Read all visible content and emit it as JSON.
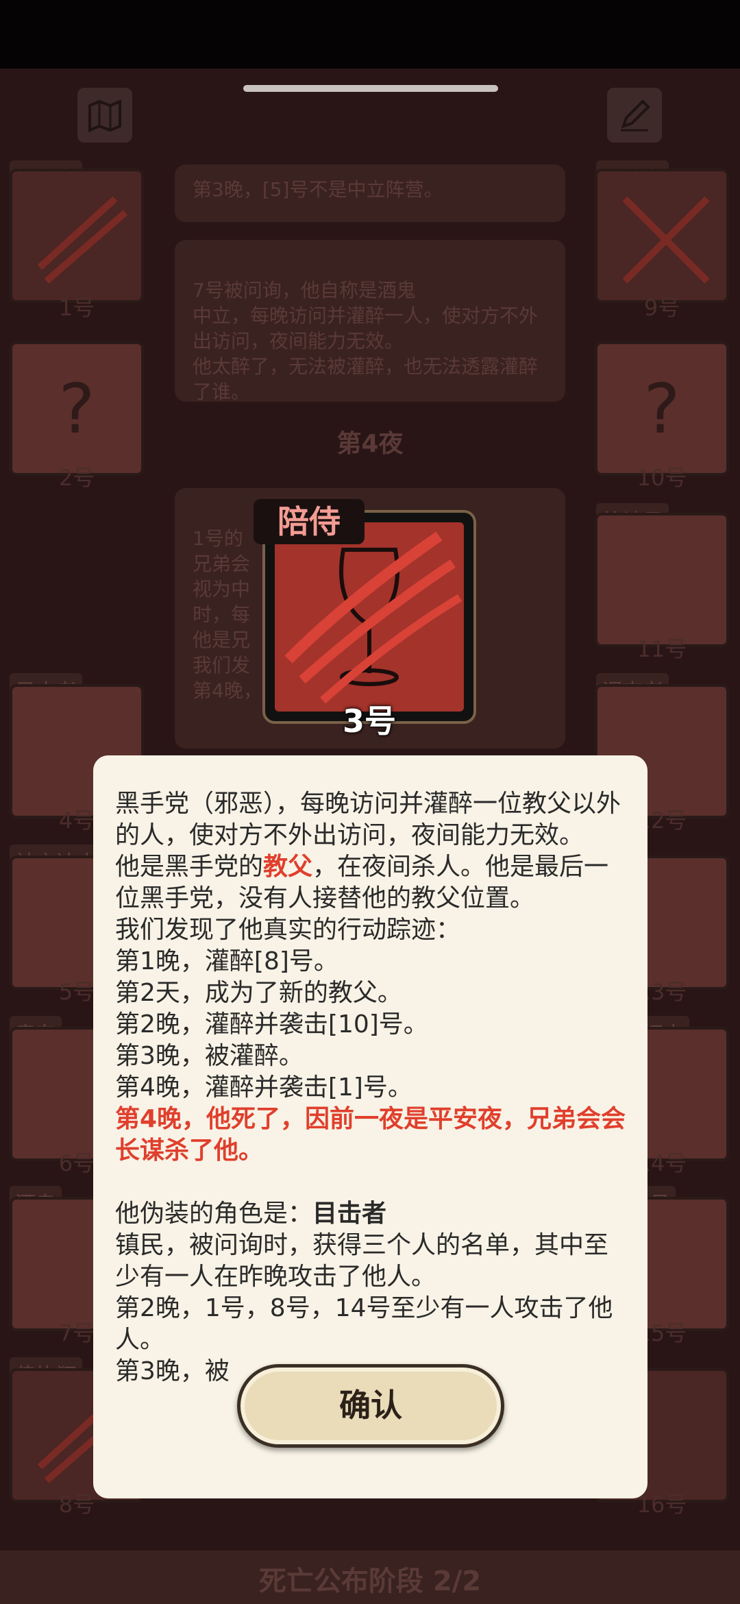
{
  "board": {
    "left_cards": [
      {
        "role": "叛变者",
        "num": "1号"
      },
      {
        "role": "",
        "num": "2号"
      },
      {
        "role": "目击者",
        "num": "4号"
      },
      {
        "role": "社交达人",
        "num": "5号"
      },
      {
        "role": "房东",
        "num": "6号"
      },
      {
        "role": "酒鬼",
        "num": "7号"
      },
      {
        "role": "偏执狂",
        "num": "8号"
      }
    ],
    "right_cards": [
      {
        "role": "伪装者",
        "num": "9号"
      },
      {
        "role": "",
        "num": "10号"
      },
      {
        "role": "统计员",
        "num": "11号"
      },
      {
        "role": "调查者",
        "num": "12号"
      },
      {
        "role": "",
        "num": "13号"
      },
      {
        "role": "证人",
        "num": "14号"
      },
      {
        "role": "员",
        "num": "15号"
      },
      {
        "role": "",
        "num": "16号"
      }
    ],
    "log1": "第3晚，[5]号不是中立阵营。",
    "log2": "7号被问询，他自称是酒鬼\n中立，每晚访问并灌醉一人，使对方不外出访问，夜间能力无效。\n他太醉了，无法被灌醉，也无法透露灌醉了谁。",
    "night_label": "第4夜",
    "log3": "1号的\n兄弟会\n视为中\n时，每\n他是兄\n我们发\n第4晚，",
    "phase": "死亡公布阶段 2/2"
  },
  "feature": {
    "badge": "陪侍",
    "num": "3号"
  },
  "dialog": {
    "p1": "黑手党（邪恶），每晚访问并灌醉一位教父以外的人，使对方不外出访问，夜间能力无效。",
    "p2_a": "他是黑手党的",
    "p2_red": "教父",
    "p2_b": "，在夜间杀人。他是最后一位黑手党，没有人接替他的教父位置。",
    "p3": "我们发现了他真实的行动踪迹：",
    "lines": [
      "第1晚，灌醉[8]号。",
      "第2天，成为了新的教父。",
      "第2晚，灌醉并袭击[10]号。",
      "第3晚，被灌醉。",
      "第4晚，灌醉并袭击[1]号。"
    ],
    "death": "第4晚，他死了，因前一夜是平安夜，兄弟会会长谋杀了他。",
    "disguise_label": "他伪装的角色是：",
    "disguise_role": "目击者",
    "disguise_desc": "镇民，被问询时，获得三个人的名单，其中至少有一人在昨晚攻击了他人。",
    "disguise_lines": [
      "第2晚，1号，8号，14号至少有一人攻击了他人。",
      "第3晚，被"
    ],
    "confirm": "确认"
  }
}
